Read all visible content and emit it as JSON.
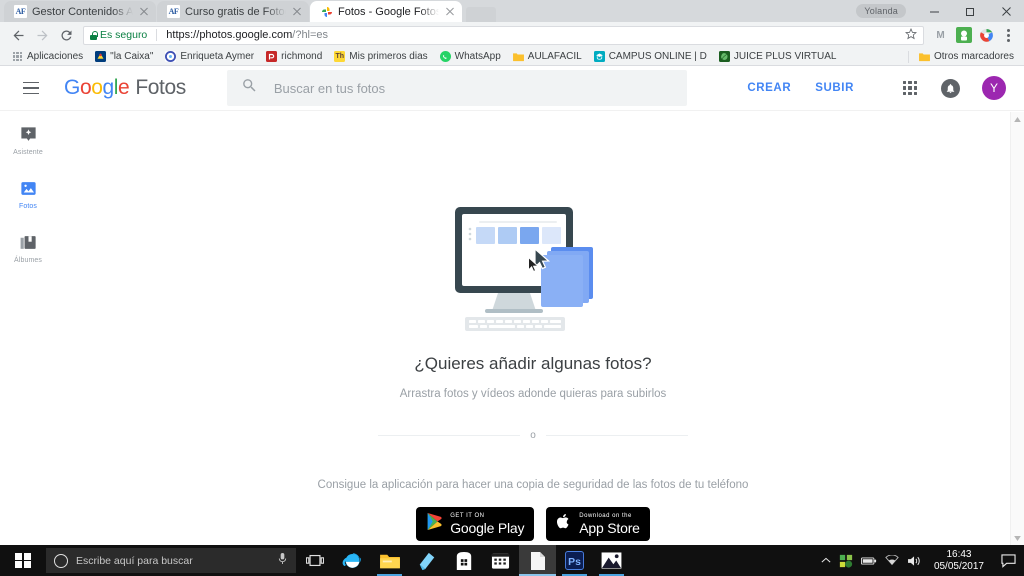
{
  "window": {
    "profile_name": "Yolanda",
    "minimize_label": "Minimizar",
    "maximize_label": "Restaurar",
    "close_label": "Cerrar"
  },
  "tabs": [
    {
      "title": "Gestor Contenidos Aula",
      "favicon": "AF",
      "active": false
    },
    {
      "title": "Curso gratis de Fotografía",
      "favicon": "AF",
      "active": false
    },
    {
      "title": "Fotos - Google Fotos",
      "favicon": "google-photos",
      "active": true
    }
  ],
  "toolbar": {
    "back_label": "Atrás",
    "forward_label": "Adelante",
    "reload_label": "Volver a cargar",
    "security_text": "Es seguro",
    "url_scheme": "https://",
    "url_host": "photos.google.com",
    "url_path": "/?hl=es",
    "bookmark_label": "Marcar esta página",
    "extensions": [
      "M",
      "extension-green",
      "extension-color"
    ],
    "menu_label": "Personaliza y controla Google Chrome"
  },
  "bookmarks": {
    "items": [
      {
        "label": "Aplicaciones",
        "icon": "apps-grid"
      },
      {
        "label": "\"la Caixa\"",
        "icon": "lacaixa"
      },
      {
        "label": "Enriqueta Aymer",
        "icon": "enriqueta"
      },
      {
        "label": "richmond",
        "icon": "richmond"
      },
      {
        "label": "Mis primeros dias",
        "icon": "misprimeros"
      },
      {
        "label": "WhatsApp",
        "icon": "whatsapp"
      },
      {
        "label": "AULAFACIL",
        "icon": "folder"
      },
      {
        "label": "CAMPUS ONLINE | D",
        "icon": "campus"
      },
      {
        "label": "JUICE PLUS VIRTUAL",
        "icon": "juiceplus"
      }
    ],
    "other_label": "Otros marcadores"
  },
  "app": {
    "menu_label": "Menú principal",
    "logo_google": "Google",
    "logo_product": "Fotos",
    "search": {
      "placeholder": "Buscar en tus fotos",
      "value": "",
      "icon": "search-icon"
    },
    "create_label": "CREAR",
    "upload_label": "SUBIR",
    "apps_label": "Aplicaciones de Google",
    "notifications_label": "Notificaciones",
    "avatar_initial": "Y",
    "avatar_color": "#9c27b0",
    "accent_color": "#4285f4"
  },
  "sidebar": {
    "items": [
      {
        "label": "Asistente",
        "icon": "assistant-icon",
        "active": false
      },
      {
        "label": "Fotos",
        "icon": "photo-icon",
        "active": true
      },
      {
        "label": "Álbumes",
        "icon": "albums-icon",
        "active": false
      }
    ]
  },
  "empty_state": {
    "title": "¿Quieres añadir algunas fotos?",
    "subtitle": "Arrastra fotos y vídeos adonde quieras para subirlos",
    "or_label": "o",
    "get_app_text": "Consigue la aplicación para hacer una copia de seguridad de las fotos de tu teléfono",
    "badges": [
      {
        "small": "GET IT ON",
        "big": "Google Play",
        "icon": "google-play-icon"
      },
      {
        "small": "Download on the",
        "big": "App Store",
        "icon": "apple-icon"
      }
    ]
  },
  "taskbar": {
    "start_label": "Inicio",
    "search_placeholder": "Escribe aquí para buscar",
    "cortana_icon": "cortana-circle-icon",
    "mic_icon": "microphone-icon",
    "task_view_label": "Vista de tareas",
    "apps": [
      {
        "name": "internet-explorer",
        "running": false,
        "active": false
      },
      {
        "name": "file-explorer",
        "running": true,
        "active": false
      },
      {
        "name": "blue-app",
        "running": false,
        "active": false
      },
      {
        "name": "microsoft-store",
        "running": false,
        "active": false
      },
      {
        "name": "calendar",
        "running": false,
        "active": false
      },
      {
        "name": "document",
        "running": true,
        "active": true
      },
      {
        "name": "photoshop",
        "running": true,
        "active": false
      },
      {
        "name": "photos",
        "running": true,
        "active": false
      }
    ],
    "tray": {
      "overflow_icon": "chevron-up-icon",
      "items": [
        "green-app-icon",
        "battery-icon",
        "wifi-icon",
        "volume-icon"
      ],
      "time": "16:43",
      "date": "05/05/2017",
      "notifications_icon": "action-center-icon"
    }
  }
}
